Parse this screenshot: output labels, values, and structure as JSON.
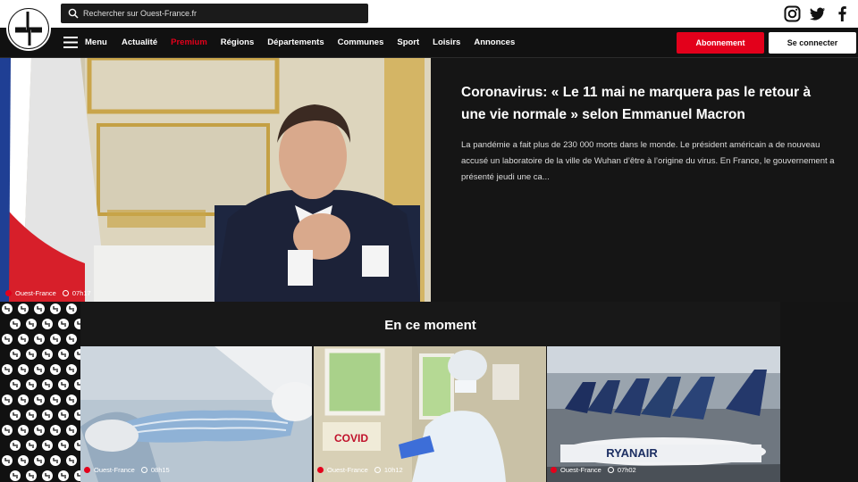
{
  "search": {
    "placeholder": "Rechercher sur Ouest-France.fr"
  },
  "header": {
    "logo": "Ouest-France logo",
    "social": [
      "instagram-icon",
      "twitter-icon",
      "facebook-icon"
    ]
  },
  "nav": {
    "menu_label": "Menu",
    "items": [
      "Actualité",
      "Premium",
      "Régions",
      "Départements",
      "Communes",
      "Sport",
      "Loisirs",
      "Annonces"
    ],
    "subscribe_label": "Abonnement",
    "login_label": "Se connecter"
  },
  "hero": {
    "title": "Coronavirus: « Le 11 mai ne marquera pas le retour à une vie normale » selon Emmanuel Macron",
    "description": "La pandémie a fait plus de 230 000 morts dans le monde. Le président américain a de nouveau accusé un laboratoire de la ville de Wuhan d’être à l’origine du virus. En France, le gouvernement a présenté jeudi une ca...",
    "source": "Ouest-France",
    "time": "07h17"
  },
  "section": {
    "title": "En ce moment",
    "cards": [
      {
        "source": "Ouest-France",
        "time": "08h15"
      },
      {
        "source": "Ouest-France",
        "time": "10h12",
        "sign": "COVID"
      },
      {
        "source": "Ouest-France",
        "time": "07h02",
        "airline": "RYANAIR"
      }
    ]
  },
  "colors": {
    "accent": "#e3001b",
    "background": "#111111",
    "panel": "#151515"
  }
}
